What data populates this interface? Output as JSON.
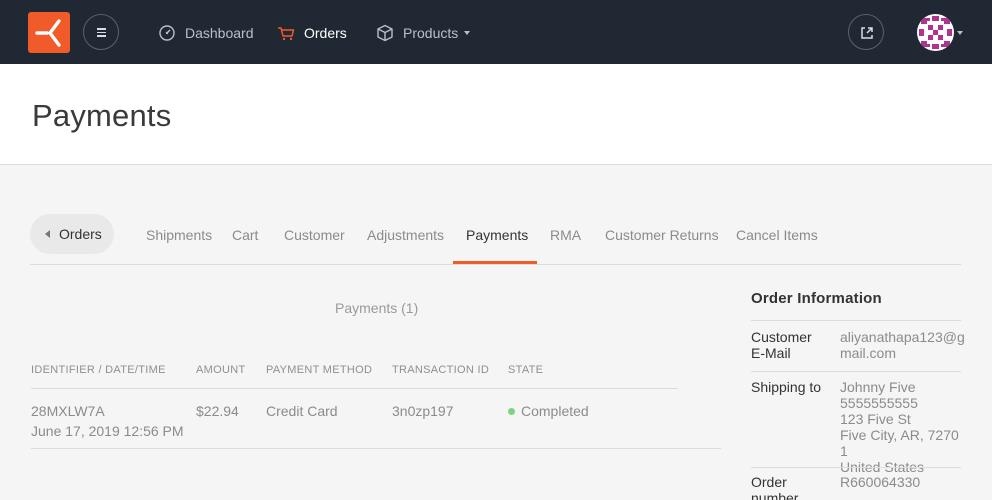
{
  "topbar": {
    "nav": [
      {
        "label": "Dashboard",
        "icon": "dashboard-icon"
      },
      {
        "label": "Orders",
        "icon": "cart-icon"
      },
      {
        "label": "Products",
        "icon": "box-icon"
      }
    ],
    "icons": {
      "logo": "solidus-logo",
      "menu": "menu-icon",
      "external": "external-link-icon",
      "avatar": "user-avatar"
    },
    "colors": {
      "bar": "#1f2833",
      "accent": "#f15a29"
    }
  },
  "page": {
    "title": "Payments"
  },
  "tabs": {
    "back": "Orders",
    "items": [
      "Shipments",
      "Cart",
      "Customer",
      "Adjustments",
      "Payments",
      "RMA",
      "Customer Returns",
      "Cancel Items"
    ],
    "active": "Payments"
  },
  "payments": {
    "count_label": "Payments (1)",
    "columns": [
      "IDENTIFIER / DATE/TIME",
      "AMOUNT",
      "PAYMENT METHOD",
      "TRANSACTION ID",
      "STATE"
    ],
    "rows": [
      {
        "identifier": "28MXLW7A",
        "date": "June 17, 2019 12:56 PM",
        "amount": "$22.94",
        "method": "Credit Card",
        "transaction_id": "3n0zp197",
        "state": "Completed",
        "state_color": "#7ed37e"
      }
    ]
  },
  "order_info": {
    "title": "Order Information",
    "fields": [
      {
        "label_lines": [
          "Customer",
          "E-Mail"
        ],
        "value_lines": [
          "aliyanathapa123@g",
          "mail.com"
        ]
      },
      {
        "label_lines": [
          "Shipping to"
        ],
        "value_lines": [
          "Johnny Five",
          "5555555555",
          "123 Five St",
          "Five City, AR, 72701",
          "United States"
        ]
      },
      {
        "label_lines": [
          "Order",
          "number"
        ],
        "value_lines": [
          "R660064330"
        ]
      }
    ]
  }
}
